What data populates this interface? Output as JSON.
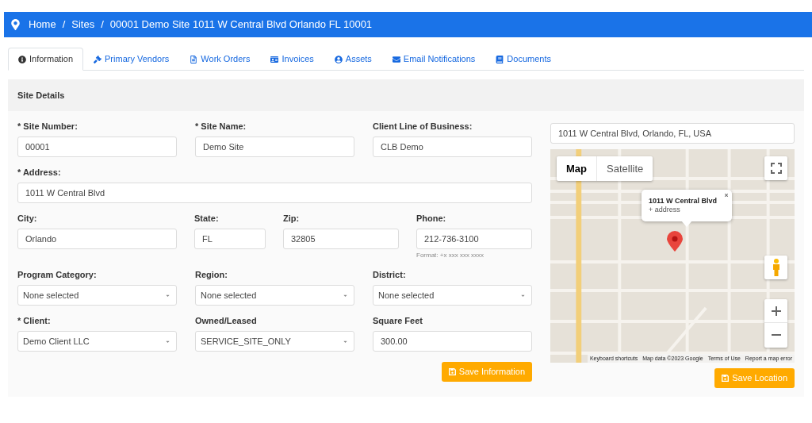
{
  "breadcrumb": [
    {
      "kind": "link",
      "label": "Home"
    },
    {
      "kind": "separator",
      "label": "/"
    },
    {
      "kind": "link",
      "label": "Sites"
    },
    {
      "kind": "separator",
      "label": "/"
    },
    {
      "kind": "current",
      "label": "00001 Demo Site 1011 W Central Blvd Orlando FL 10001"
    }
  ],
  "tabs": [
    {
      "label": "Information",
      "selected": true
    },
    {
      "label": "Primary Vendors",
      "selected": false
    },
    {
      "label": "Work Orders",
      "selected": false
    },
    {
      "label": "Invoices",
      "selected": false
    },
    {
      "label": "Assets",
      "selected": false
    },
    {
      "label": "Email Notifications",
      "selected": false
    },
    {
      "label": "Documents",
      "selected": false
    }
  ],
  "panel": {
    "title": "Site Details",
    "rows": [
      [
        {
          "kind": "text",
          "label": "* Site Number:",
          "value": "00001"
        },
        {
          "kind": "text",
          "label": "* Site Name:",
          "value": "Demo Site"
        },
        {
          "kind": "text",
          "label": "Client Line of Business:",
          "value": "CLB Demo"
        }
      ],
      [
        {
          "kind": "text",
          "label": "* Address:",
          "value": "1011 W Central Blvd"
        }
      ],
      [
        {
          "kind": "text",
          "label": "City:",
          "value": "Orlando"
        },
        {
          "kind": "text",
          "label": "State:",
          "value": "FL"
        },
        {
          "kind": "text",
          "label": "Zip:",
          "value": "32805"
        },
        {
          "kind": "text",
          "label": "Phone:",
          "value": "212-736-3100",
          "hint": "Format: +x xxx xxx xxxx"
        }
      ],
      [
        {
          "kind": "select",
          "label": "Program Category:",
          "value": "None selected"
        },
        {
          "kind": "select",
          "label": "Region:",
          "value": "None selected"
        },
        {
          "kind": "select",
          "label": "District:",
          "value": "None selected"
        }
      ],
      [
        {
          "kind": "select",
          "label": "* Client:",
          "value": "Demo Client LLC"
        },
        {
          "kind": "select",
          "label": "Owned/Leased",
          "value": "SERVICE_SITE_ONLY"
        },
        {
          "kind": "text",
          "label": "Square Feet",
          "value": "300.00"
        }
      ]
    ],
    "save_button": {
      "label": "Save Information"
    },
    "location": {
      "address_field": {
        "value": "1011 W Central Blvd, Orlando, FL, USA"
      },
      "map": {
        "map_types": [
          {
            "label": "Map",
            "selected": true
          },
          {
            "label": "Satellite",
            "selected": false
          }
        ],
        "info_window": {
          "title": "1011 W Central Blvd",
          "subtitle": "+ address"
        },
        "attribution": [
          "Keyboard shortcuts",
          "Map data ©2023 Google",
          "Terms of Use",
          "Report a map error"
        ]
      },
      "save_button": {
        "label": "Save Location"
      }
    }
  }
}
